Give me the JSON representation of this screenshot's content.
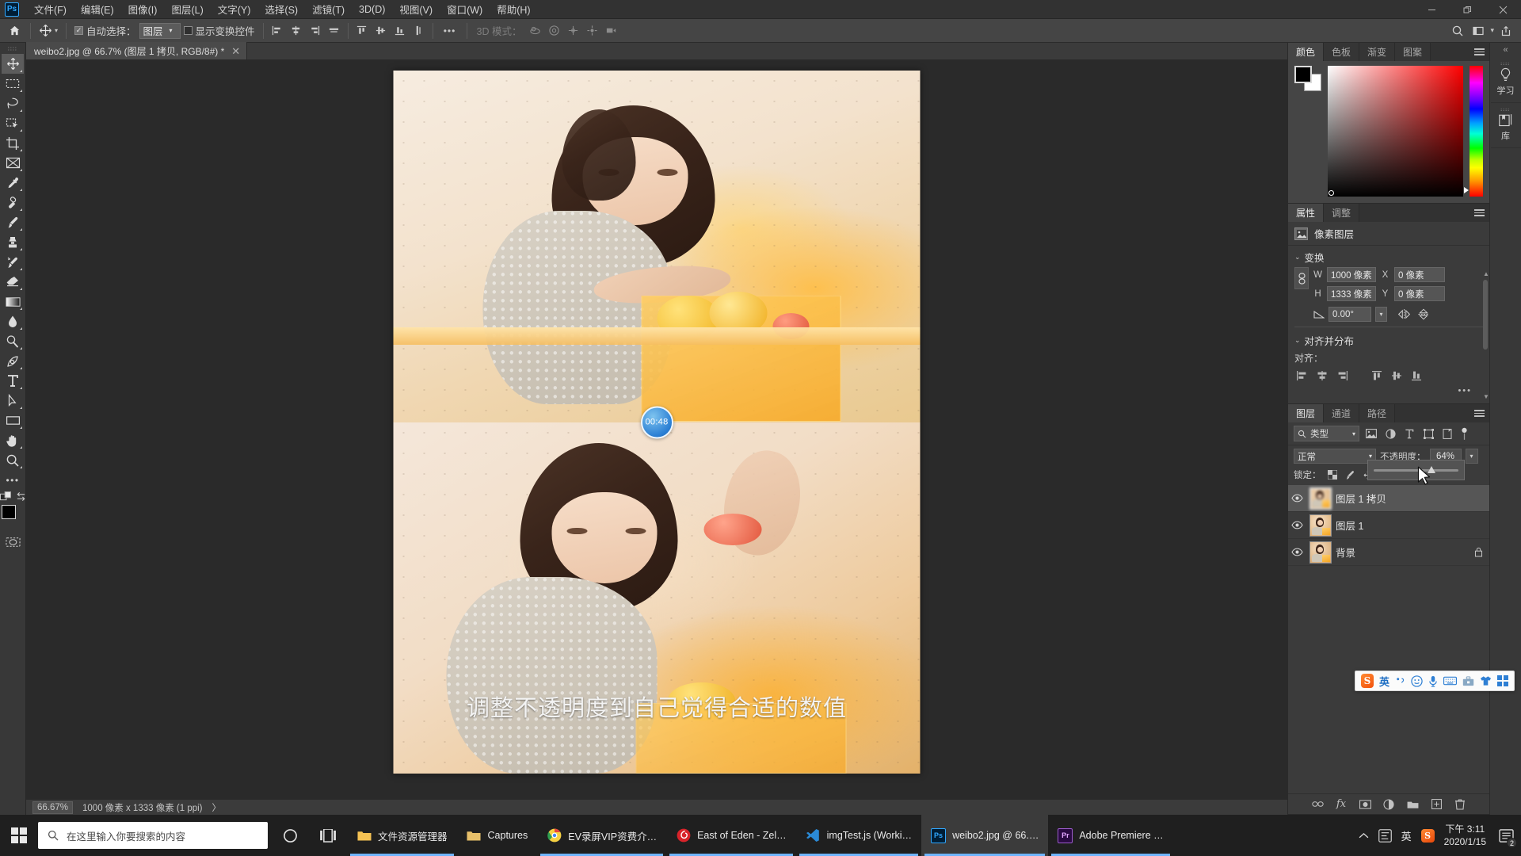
{
  "app": {
    "name": "Adobe Photoshop",
    "logo_text": "Ps"
  },
  "menubar": {
    "items": [
      {
        "label": "文件(F)",
        "name": "menu-file"
      },
      {
        "label": "编辑(E)",
        "name": "menu-edit"
      },
      {
        "label": "图像(I)",
        "name": "menu-image"
      },
      {
        "label": "图层(L)",
        "name": "menu-layer"
      },
      {
        "label": "文字(Y)",
        "name": "menu-type"
      },
      {
        "label": "选择(S)",
        "name": "menu-select"
      },
      {
        "label": "滤镜(T)",
        "name": "menu-filter"
      },
      {
        "label": "3D(D)",
        "name": "menu-3d"
      },
      {
        "label": "视图(V)",
        "name": "menu-view"
      },
      {
        "label": "窗口(W)",
        "name": "menu-window"
      },
      {
        "label": "帮助(H)",
        "name": "menu-help"
      }
    ],
    "window_controls": {
      "minimize": "—",
      "restore": "❐",
      "close": "✕"
    }
  },
  "options_bar": {
    "auto_select_label": "自动选择：",
    "auto_select_checked": true,
    "auto_select_value": "图层",
    "show_transform_label": "显示变换控件",
    "show_transform_checked": false,
    "more_options": "•••",
    "mode_3d_label": "3D 模式：",
    "overflow": "•••"
  },
  "document_tab": {
    "title": "weibo2.jpg @ 66.7% (图层 1 拷贝, RGB/8#) *",
    "close": "✕"
  },
  "status_bar": {
    "zoom": "66.67%",
    "dimensions": "1000 像素 x 1333 像素 (1 ppi)",
    "arrow": "〉"
  },
  "canvas": {
    "timer_badge": "00:48",
    "subtitle": "调整不透明度到自己觉得合适的数值",
    "accent_blue": "#2b7fd4"
  },
  "color_panel": {
    "tabs": [
      "颜色",
      "色板",
      "渐变",
      "图案"
    ],
    "active_tab": "颜色",
    "foreground": "#000000",
    "background": "#ffffff"
  },
  "properties_panel": {
    "tabs": [
      "属性",
      "调整"
    ],
    "active_tab": "属性",
    "layer_kind": "像素图层",
    "transform": {
      "section_label": "变换",
      "w_label": "W",
      "w_value": "1000 像素",
      "h_label": "H",
      "h_value": "1333 像素",
      "x_label": "X",
      "x_value": "0 像素",
      "y_label": "Y",
      "y_value": "0 像素",
      "angle_value": "0.00°"
    },
    "align": {
      "section_label": "对齐并分布",
      "align_label": "对齐：",
      "more": "•••"
    }
  },
  "layers_panel": {
    "tabs": [
      "图层",
      "通道",
      "路径"
    ],
    "active_tab": "图层",
    "filter_type": "类型",
    "blend_mode": "正常",
    "opacity_label": "不透明度：",
    "opacity_value": "64%",
    "lock_label": "锁定：",
    "rows": [
      {
        "name": "图层 1 拷贝",
        "visible": true,
        "selected": true,
        "locked": false
      },
      {
        "name": "图层 1",
        "visible": true,
        "selected": false,
        "locked": false
      },
      {
        "name": "背景",
        "visible": true,
        "selected": false,
        "locked": true
      }
    ]
  },
  "collapsed_panels": {
    "collapse_arrows": "«",
    "items": [
      {
        "label": "学习",
        "icon": "lightbulb-icon"
      },
      {
        "label": "库",
        "icon": "library-icon"
      }
    ]
  },
  "ime_bar": {
    "logo": "S",
    "mode": "英",
    "icons": [
      "punctuation-icon",
      "emoji-icon",
      "microphone-icon",
      "keyboard-icon",
      "toolbox-icon",
      "skin-icon",
      "apps-icon"
    ]
  },
  "taskbar": {
    "search_placeholder": "在这里输入你要搜索的内容",
    "apps": [
      {
        "label": "文件资源管理器",
        "icon": "folder-icon",
        "color": "#f5c253",
        "active": false,
        "running": true
      },
      {
        "label": "Captures",
        "icon": "folder-icon",
        "color": "#e8c06a",
        "active": false,
        "running": false
      },
      {
        "label": "EV录屏VIP资费介…",
        "icon": "chrome-icon",
        "color": "#e8453c",
        "active": false,
        "running": true
      },
      {
        "label": "East of Eden - Zel…",
        "icon": "netease-icon",
        "color": "#d8232a",
        "active": false,
        "running": true
      },
      {
        "label": "imgTest.js (Worki…",
        "icon": "vscode-icon",
        "color": "#2b8ad6",
        "active": false,
        "running": true
      },
      {
        "label": "weibo2.jpg @ 66.…",
        "icon": "photoshop-icon",
        "color": "#001e36",
        "active": true,
        "running": true
      },
      {
        "label": "Adobe Premiere …",
        "icon": "premiere-icon",
        "color": "#2a0a42",
        "active": false,
        "running": true
      }
    ],
    "tray": {
      "chevron": "ᨈ",
      "ime_mode": "英",
      "sogou": "S"
    },
    "clock": {
      "time": "下午 3:11",
      "date": "2020/1/15"
    },
    "notification_count": "2"
  }
}
